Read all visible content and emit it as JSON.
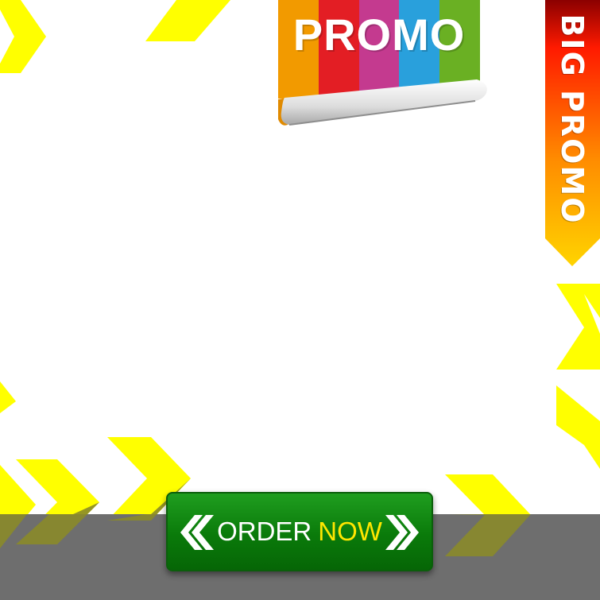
{
  "promo_banner": {
    "label": "PROMO",
    "stripe_colors": [
      "#f29a00",
      "#e31e24",
      "#c43a8f",
      "#29a0dc",
      "#6ab023"
    ]
  },
  "ribbon": {
    "label": "BIG PROMO",
    "gradient": [
      "#8b0000",
      "#ff1a00",
      "#ff8c00",
      "#ffd400"
    ]
  },
  "order_button": {
    "word_order": "ORDER",
    "word_now": "NOW",
    "left_icon": "double-chevron-left-icon",
    "right_icon": "double-chevron-right-icon"
  },
  "colors": {
    "accent_yellow": "#ffff00",
    "bottom_bar": "#6e6e6e",
    "button_green": "#0a7a0a",
    "now_yellow": "#ffe600"
  }
}
